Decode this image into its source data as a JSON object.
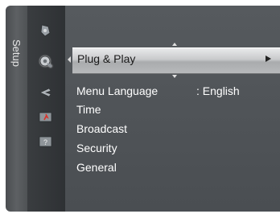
{
  "sidebar": {
    "tab_label": "Setup",
    "icons": [
      {
        "name": "picture-icon"
      },
      {
        "name": "setup-gear-icon",
        "active": true
      },
      {
        "name": "input-icon"
      },
      {
        "name": "application-icon"
      },
      {
        "name": "support-icon"
      }
    ]
  },
  "menu": {
    "selected_item": "Plug & Play",
    "items": [
      {
        "label": "Menu Language",
        "value": ": English"
      },
      {
        "label": "Time"
      },
      {
        "label": "Broadcast"
      },
      {
        "label": "Security"
      },
      {
        "label": "General"
      }
    ]
  },
  "colors": {
    "tab_strip": "#55585b",
    "icon_column": "#34373a",
    "panel": "#515559",
    "highlight": "#c8c9cb",
    "text": "#ffffff"
  }
}
